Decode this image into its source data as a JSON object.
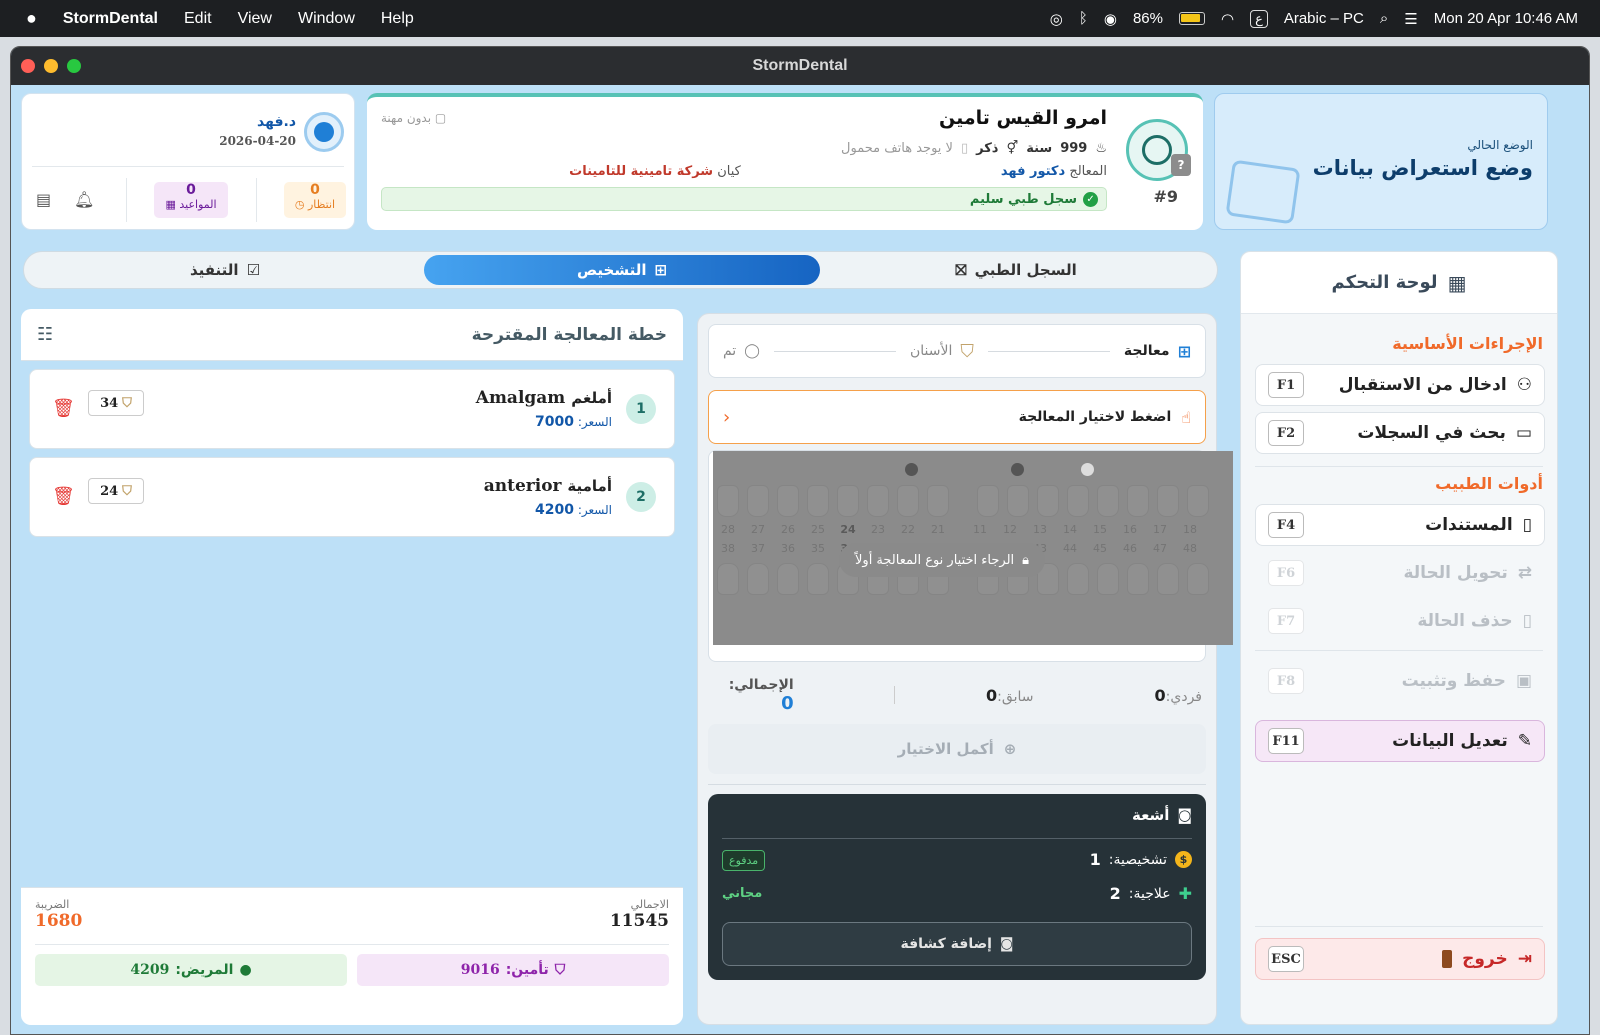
{
  "menubar": {
    "app": "StormDental",
    "items": [
      "Edit",
      "View",
      "Window",
      "Help"
    ],
    "battery": "86%",
    "input": "Arabic – PC",
    "datetime": "Mon 20 Apr  10:46 AM",
    "input_glyph": "ع"
  },
  "window": {
    "title": "StormDental"
  },
  "mode": {
    "caption": "الوضع الحالي",
    "title": "وضع استعراض بيانات"
  },
  "patient": {
    "name": "امرو القيس تامين",
    "job": "بدون مهنة",
    "age_num": "999",
    "age_unit": "سنة",
    "gender": "ذكر",
    "phone": "لا يوجد هاتف محمول",
    "doctor_label": "المعالج",
    "doctor": "دكتور فهد",
    "entity_label": "كيان",
    "entity": "شركة تامينية للتامينات",
    "record": "سجل طبي سليم",
    "id": "#9"
  },
  "doctor_card": {
    "name": "د.فهد",
    "date": "2026-04-20",
    "waiting_count": "0",
    "waiting_label": "انتظار",
    "appointments_count": "0",
    "appointments_label": "المواعيد"
  },
  "tabs": {
    "records": "السجل الطبي",
    "diagnosis": "التشخيص",
    "execution": "التنفيذ"
  },
  "sidebar": {
    "title": "لوحة التحكم",
    "section1": "الإجراءات الأساسية",
    "section2": "أدوات الطبيب",
    "btn_f1": {
      "label": "ادخال من الاستقبال",
      "key": "F1"
    },
    "btn_f2": {
      "label": "بحث في السجلات",
      "key": "F2"
    },
    "btn_f4": {
      "label": "المستندات",
      "key": "F4"
    },
    "btn_f6": {
      "label": "تحويل الحالة",
      "key": "F6"
    },
    "btn_f7": {
      "label": "حذف الحالة",
      "key": "F7"
    },
    "btn_f8": {
      "label": "حفظ وتثبيت",
      "key": "F8"
    },
    "btn_f11": {
      "label": "تعديل البيانات",
      "key": "F11"
    },
    "btn_esc": {
      "label": "خروج",
      "key": "ESC"
    }
  },
  "steps": {
    "s1": "معالجة",
    "s2": "الأسنان",
    "s3": "تم"
  },
  "select_treatment": "اضغط لاختيار المعالجة",
  "chart_lock": "الرجاء اختيار نوع المعالجة أولاً",
  "teeth": {
    "upper": [
      "28",
      "27",
      "26",
      "25",
      "24",
      "23",
      "22",
      "21",
      "11",
      "12",
      "13",
      "14",
      "15",
      "16",
      "17",
      "18"
    ],
    "lower": [
      "38",
      "37",
      "36",
      "35",
      "34",
      "33",
      "32",
      "31",
      "41",
      "42",
      "43",
      "44",
      "45",
      "46",
      "47",
      "48"
    ]
  },
  "totals": {
    "individual_label": "فردي:",
    "individual": "0",
    "prev_label": "سابق:",
    "prev": "0",
    "total_label": "الإجمالي:",
    "total": "0"
  },
  "complete_btn": "أكمل الاختيار",
  "xray": {
    "title": "أشعة",
    "diag_label": "تشخيصية:",
    "diag": "1",
    "treat_label": "علاجية:",
    "treat": "2",
    "paid": "مدفوع",
    "free": "مجاني",
    "add_btn": "إضافة كشافة"
  },
  "plan": {
    "title": "خطة المعالجة المقترحة",
    "price_label": "السعر:",
    "items": [
      {
        "n": "1",
        "name_ar": "أملغم",
        "name_en": "Amalgam",
        "price": "7000",
        "tooth": "34"
      },
      {
        "n": "2",
        "name_ar": "أمامية",
        "name_en": "anterior",
        "price": "4200",
        "tooth": "24"
      }
    ],
    "total_label": "الاجمالي",
    "total": "11545",
    "tax_label": "الضريبة",
    "tax": "1680",
    "insurance_label": "تأمين:",
    "insurance": "9016",
    "patient_label": "المريض:",
    "patient": "4209"
  },
  "colors": {
    "accent": "#1f7fd6",
    "orange": "#f06a2a",
    "green": "#1e9e4a",
    "purple": "#8e24aa"
  }
}
